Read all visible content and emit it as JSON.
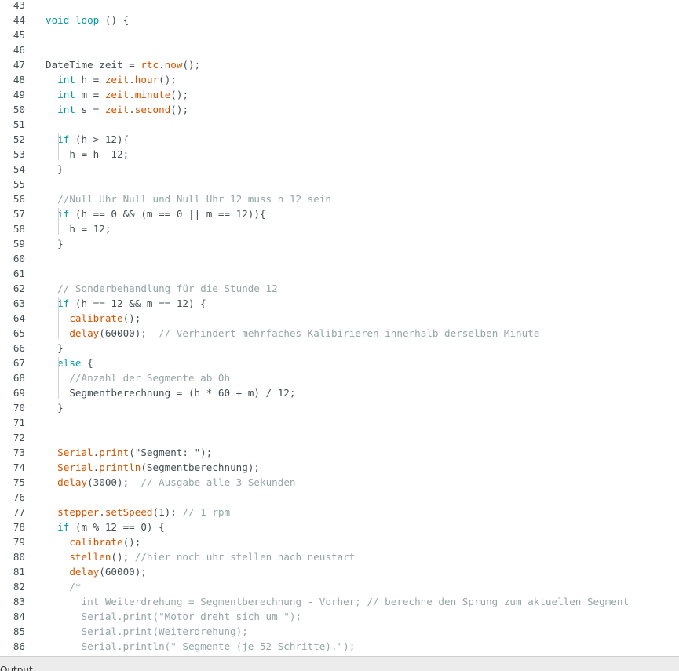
{
  "editor": {
    "lines": [
      {
        "n": "43",
        "t": []
      },
      {
        "n": "44",
        "t": [
          [
            "kw",
            "void"
          ],
          [
            "tx",
            " "
          ],
          [
            "kw",
            "loop"
          ],
          [
            "tx",
            " () {"
          ]
        ]
      },
      {
        "n": "45",
        "t": []
      },
      {
        "n": "46",
        "t": []
      },
      {
        "n": "47",
        "t": [
          [
            "tx",
            "DateTime zeit = "
          ],
          [
            "fn",
            "rtc"
          ],
          [
            "tx",
            "."
          ],
          [
            "fn",
            "now"
          ],
          [
            "tx",
            "();"
          ]
        ]
      },
      {
        "n": "48",
        "t": [
          [
            "tx",
            "  "
          ],
          [
            "kw",
            "int"
          ],
          [
            "tx",
            " h = "
          ],
          [
            "fn",
            "zeit"
          ],
          [
            "tx",
            "."
          ],
          [
            "fn",
            "hour"
          ],
          [
            "tx",
            "();"
          ]
        ]
      },
      {
        "n": "49",
        "t": [
          [
            "tx",
            "  "
          ],
          [
            "kw",
            "int"
          ],
          [
            "tx",
            " m = "
          ],
          [
            "fn",
            "zeit"
          ],
          [
            "tx",
            "."
          ],
          [
            "fn",
            "minute"
          ],
          [
            "tx",
            "();"
          ]
        ]
      },
      {
        "n": "50",
        "t": [
          [
            "tx",
            "  "
          ],
          [
            "kw",
            "int"
          ],
          [
            "tx",
            " s = "
          ],
          [
            "fn",
            "zeit"
          ],
          [
            "tx",
            "."
          ],
          [
            "fn",
            "second"
          ],
          [
            "tx",
            "();"
          ]
        ]
      },
      {
        "n": "51",
        "t": []
      },
      {
        "n": "52",
        "t": [
          [
            "tx",
            "  "
          ],
          [
            "kw",
            "if"
          ],
          [
            "tx",
            " (h > 12){"
          ]
        ]
      },
      {
        "n": "53",
        "t": [
          [
            "tx",
            "    h = h -12;"
          ]
        ]
      },
      {
        "n": "54",
        "t": [
          [
            "tx",
            "  }"
          ]
        ]
      },
      {
        "n": "55",
        "t": []
      },
      {
        "n": "56",
        "t": [
          [
            "tx",
            "  "
          ],
          [
            "cm",
            "//Null Uhr Null und Null Uhr 12 muss h 12 sein"
          ]
        ]
      },
      {
        "n": "57",
        "t": [
          [
            "tx",
            "  "
          ],
          [
            "kw",
            "if"
          ],
          [
            "tx",
            " (h == 0 && (m == 0 || m == 12)){"
          ]
        ]
      },
      {
        "n": "58",
        "t": [
          [
            "tx",
            "    h = 12;"
          ]
        ]
      },
      {
        "n": "59",
        "t": [
          [
            "tx",
            "  }"
          ]
        ]
      },
      {
        "n": "60",
        "t": []
      },
      {
        "n": "61",
        "t": []
      },
      {
        "n": "62",
        "t": [
          [
            "tx",
            "  "
          ],
          [
            "cm",
            "// Sonderbehandlung für die Stunde 12"
          ]
        ]
      },
      {
        "n": "63",
        "t": [
          [
            "tx",
            "  "
          ],
          [
            "kw",
            "if"
          ],
          [
            "tx",
            " (h == 12 && m == 12) {"
          ]
        ]
      },
      {
        "n": "64",
        "t": [
          [
            "tx",
            "    "
          ],
          [
            "fn",
            "calibrate"
          ],
          [
            "tx",
            "();"
          ]
        ]
      },
      {
        "n": "65",
        "t": [
          [
            "tx",
            "    "
          ],
          [
            "fn",
            "delay"
          ],
          [
            "tx",
            "(60000);  "
          ],
          [
            "cm",
            "// Verhindert mehrfaches Kalibirieren innerhalb derselben Minute"
          ]
        ]
      },
      {
        "n": "66",
        "t": [
          [
            "tx",
            "  }"
          ]
        ]
      },
      {
        "n": "67",
        "t": [
          [
            "tx",
            "  "
          ],
          [
            "kw",
            "else"
          ],
          [
            "tx",
            " {"
          ]
        ]
      },
      {
        "n": "68",
        "t": [
          [
            "tx",
            "    "
          ],
          [
            "cm",
            "//Anzahl der Segmente ab 0h"
          ]
        ]
      },
      {
        "n": "69",
        "t": [
          [
            "tx",
            "    Segmentberechnung = (h * 60 + m) / 12;"
          ]
        ]
      },
      {
        "n": "70",
        "t": [
          [
            "tx",
            "  }"
          ]
        ]
      },
      {
        "n": "71",
        "t": []
      },
      {
        "n": "72",
        "t": []
      },
      {
        "n": "73",
        "t": [
          [
            "tx",
            "  "
          ],
          [
            "fn",
            "Serial"
          ],
          [
            "tx",
            "."
          ],
          [
            "fn",
            "print"
          ],
          [
            "tx",
            "(\"Segment: \");"
          ]
        ]
      },
      {
        "n": "74",
        "t": [
          [
            "tx",
            "  "
          ],
          [
            "fn",
            "Serial"
          ],
          [
            "tx",
            "."
          ],
          [
            "fn",
            "println"
          ],
          [
            "tx",
            "(Segmentberechnung);"
          ]
        ]
      },
      {
        "n": "75",
        "t": [
          [
            "tx",
            "  "
          ],
          [
            "fn",
            "delay"
          ],
          [
            "tx",
            "(3000);  "
          ],
          [
            "cm",
            "// Ausgabe alle 3 Sekunden"
          ]
        ]
      },
      {
        "n": "76",
        "t": []
      },
      {
        "n": "77",
        "t": [
          [
            "tx",
            "  "
          ],
          [
            "fn",
            "stepper"
          ],
          [
            "tx",
            "."
          ],
          [
            "fn",
            "setSpeed"
          ],
          [
            "tx",
            "(1); "
          ],
          [
            "cm",
            "// 1 rpm"
          ]
        ]
      },
      {
        "n": "78",
        "t": [
          [
            "tx",
            "  "
          ],
          [
            "kw",
            "if"
          ],
          [
            "tx",
            " (m % 12 == 0) {"
          ]
        ]
      },
      {
        "n": "79",
        "t": [
          [
            "tx",
            "    "
          ],
          [
            "fn",
            "calibrate"
          ],
          [
            "tx",
            "();"
          ]
        ]
      },
      {
        "n": "80",
        "t": [
          [
            "tx",
            "    "
          ],
          [
            "fn",
            "stellen"
          ],
          [
            "tx",
            "(); "
          ],
          [
            "cm",
            "//hier noch uhr stellen nach neustart"
          ]
        ]
      },
      {
        "n": "81",
        "t": [
          [
            "tx",
            "    "
          ],
          [
            "fn",
            "delay"
          ],
          [
            "tx",
            "(60000);"
          ]
        ]
      },
      {
        "n": "82",
        "t": [
          [
            "tx",
            "    "
          ],
          [
            "cm",
            "/*"
          ]
        ]
      },
      {
        "n": "83",
        "t": [
          [
            "tx",
            "      "
          ],
          [
            "cm",
            "int Weiterdrehung = Segmentberechnung - Vorher; // berechne den Sprung zum aktuellen Segment"
          ]
        ]
      },
      {
        "n": "84",
        "t": [
          [
            "tx",
            "      "
          ],
          [
            "cm",
            "Serial.print(\"Motor dreht sich um \");"
          ]
        ]
      },
      {
        "n": "85",
        "t": [
          [
            "tx",
            "      "
          ],
          [
            "cm",
            "Serial.print(Weiterdrehung);"
          ]
        ]
      },
      {
        "n": "86",
        "t": [
          [
            "tx",
            "      "
          ],
          [
            "cm",
            "Serial.println(\" Segmente (je 52 Schritte).\");"
          ]
        ]
      }
    ]
  },
  "bottom_panel": {
    "tab_label": "Output"
  }
}
